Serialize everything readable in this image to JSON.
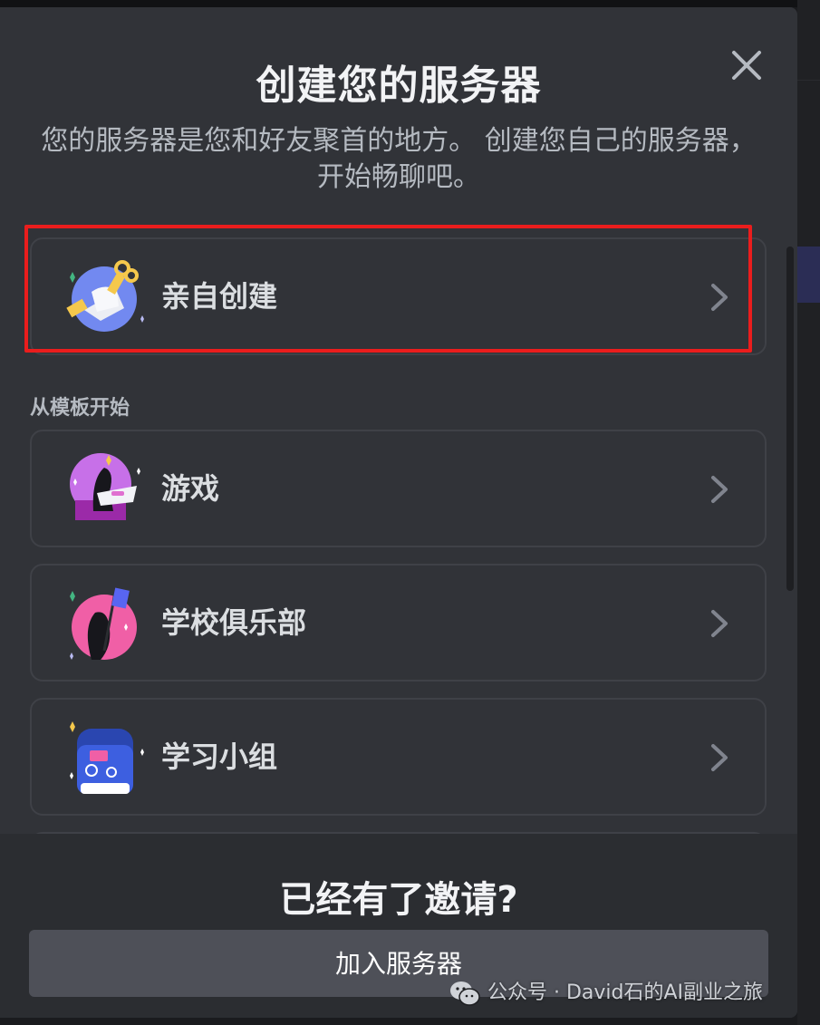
{
  "modal": {
    "title": "创建您的服务器",
    "subtitle": "您的服务器是您和好友聚首的地方。 创建您自己的服务器，开始畅聊吧。"
  },
  "options": {
    "create_own": {
      "label": "亲自创建",
      "icon": "key-hand-icon"
    },
    "template_header": "从模板开始",
    "templates": [
      {
        "label": "游戏",
        "icon": "gaming-icon"
      },
      {
        "label": "学校俱乐部",
        "icon": "school-club-icon"
      },
      {
        "label": "学习小组",
        "icon": "study-group-backpack-icon"
      }
    ]
  },
  "footer": {
    "title": "已经有了邀请?",
    "join_button": "加入服务器"
  },
  "watermark": {
    "text": "公众号 · David石的AI副业之旅",
    "icon": "wechat-icon"
  },
  "colors": {
    "modal_bg": "#313338",
    "footer_bg": "#2b2d31",
    "button_bg": "#4e5058",
    "highlight": "#ea1d1d"
  }
}
